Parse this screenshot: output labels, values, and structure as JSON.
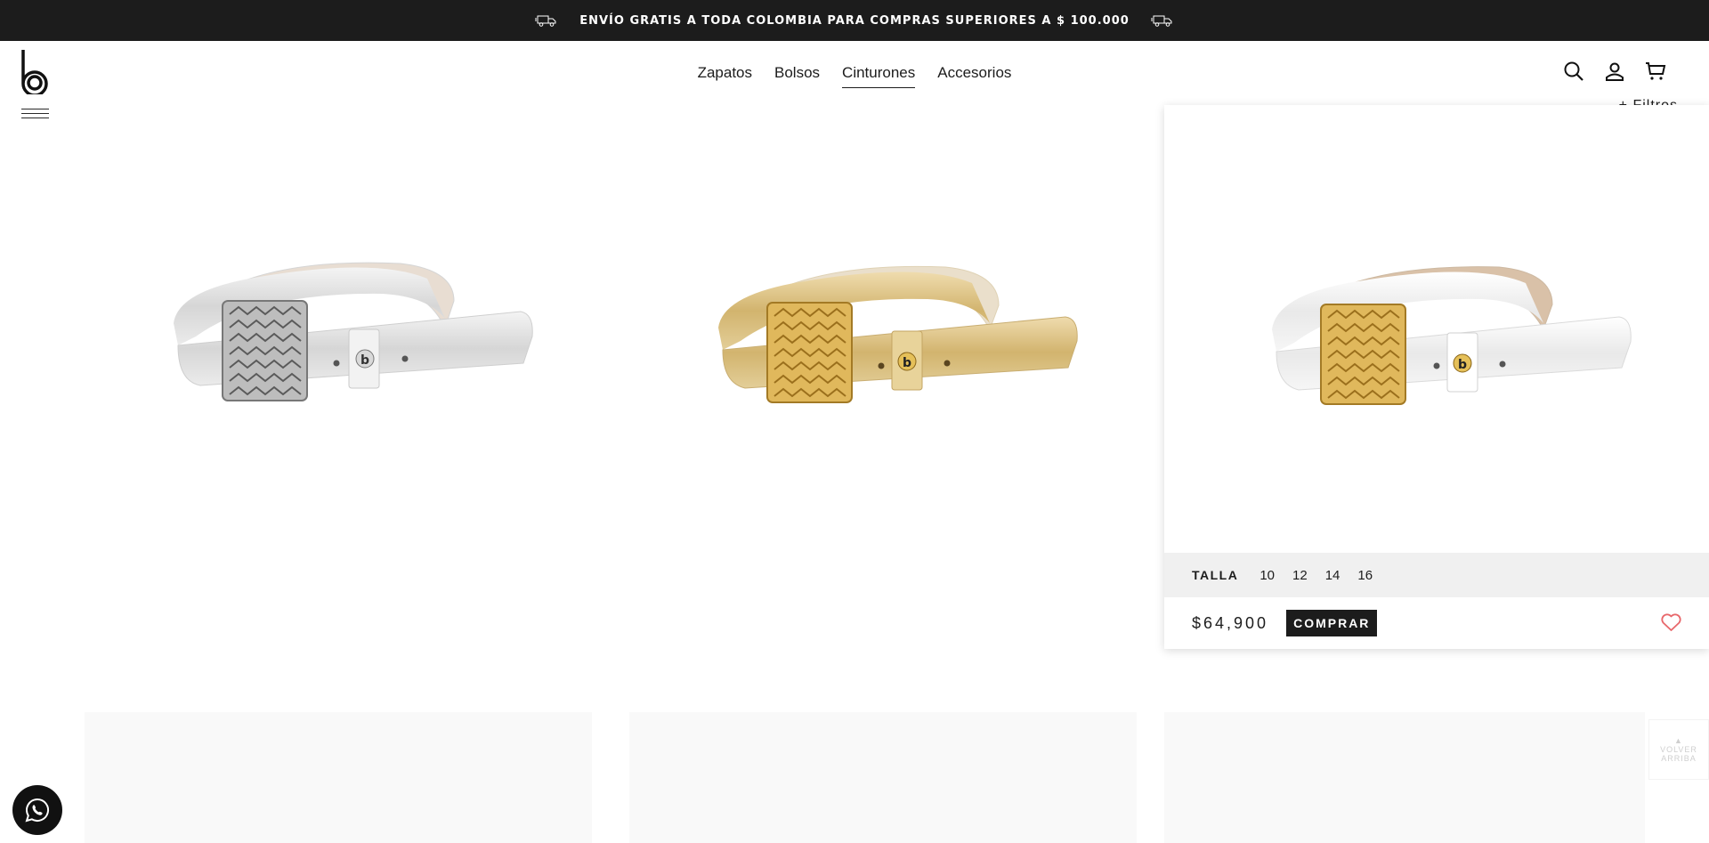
{
  "promo_bar": {
    "text": "ENVÍO GRATIS A TODA COLOMBIA PARA COMPRAS SUPERIORES A $ 100.000"
  },
  "nav": {
    "items": [
      {
        "label": "Zapatos",
        "active": false
      },
      {
        "label": "Bolsos",
        "active": false
      },
      {
        "label": "Cinturones",
        "active": true
      },
      {
        "label": "Accesorios",
        "active": false
      }
    ]
  },
  "filters_label": "+ Filtros",
  "products": [
    {
      "color": "silver",
      "image": "silver-belt"
    },
    {
      "color": "gold",
      "image": "gold-belt"
    }
  ],
  "hover_card": {
    "image": "white-belt-gold-buckle",
    "size_label": "TALLA",
    "sizes": [
      "10",
      "12",
      "14",
      "16"
    ],
    "price": "$64,900",
    "buy_label": "COMPRAR"
  },
  "back_to_top": {
    "line1": "VOLVER",
    "line2": "ARRIBA"
  },
  "colors": {
    "topbar_bg": "#1c1c1c",
    "heart": "#e8676b",
    "size_row_bg": "#f0f0f0"
  }
}
